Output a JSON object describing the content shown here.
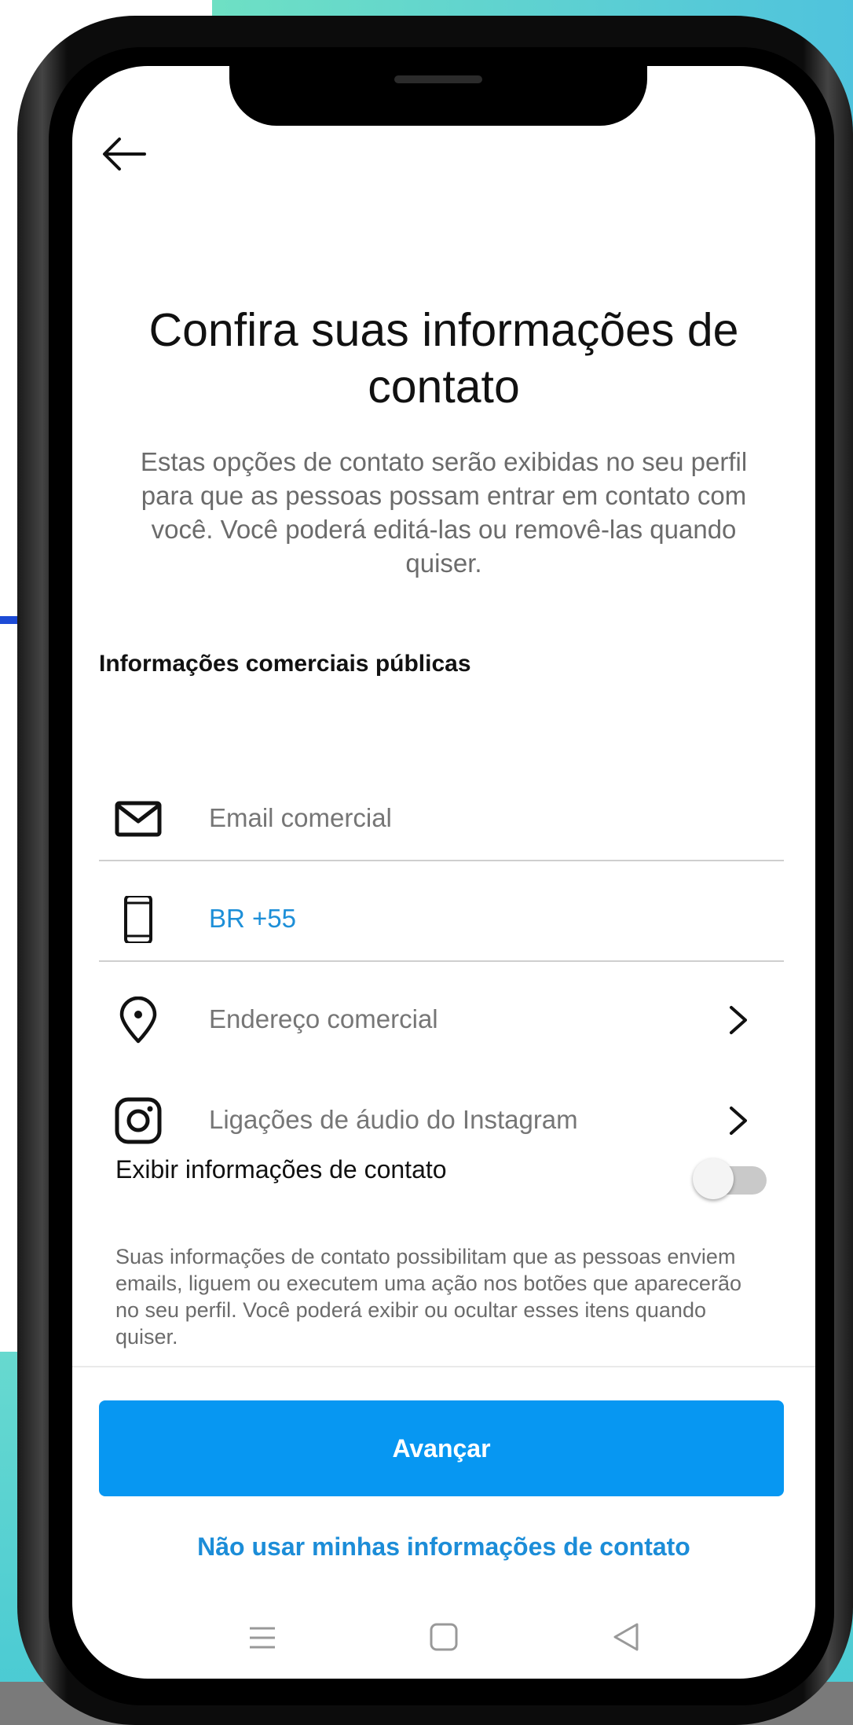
{
  "page": {
    "title": "Confira suas informações de contato",
    "subtitle": "Estas opções de contato serão exibidas no seu perfil para que as pessoas possam entrar em contato com você. Você poderá editá-las ou removê-las quando quiser."
  },
  "section": {
    "title": "Informações comerciais públicas"
  },
  "fields": {
    "email": {
      "placeholder": "Email comercial",
      "icon": "mail-icon"
    },
    "phone": {
      "value": "BR +55",
      "icon": "phone-icon"
    },
    "address": {
      "label": "Endereço comercial",
      "icon": "location-pin-icon"
    },
    "calls": {
      "label": "Ligações de áudio do Instagram",
      "icon": "instagram-icon"
    }
  },
  "toggle": {
    "label": "Exibir informações de contato",
    "enabled": false
  },
  "note": "Suas informações de contato possibilitam que as pessoas enviem emails, liguem ou executem uma ação nos botões que aparecerão no seu perfil. Você poderá exibir ou ocultar esses itens quando quiser.",
  "actions": {
    "primary": "Avançar",
    "secondary": "Não usar minhas informações de contato"
  },
  "colors": {
    "accent": "#0797f2",
    "link": "#1c8dd8"
  },
  "icons": {
    "back": "arrow-left-icon",
    "nav_menu": "menu-lines-icon",
    "nav_home": "square-home-icon",
    "nav_back": "triangle-back-icon"
  }
}
